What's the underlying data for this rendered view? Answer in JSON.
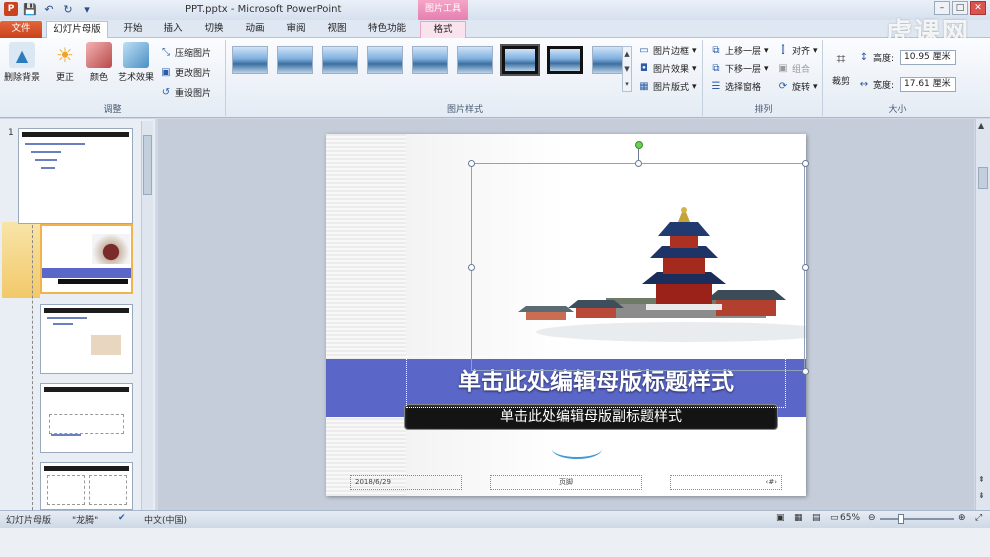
{
  "app": {
    "window_title": "PPT.pptx - Microsoft PowerPoint",
    "context_tool_header": "图片工具",
    "watermark": "虎课网"
  },
  "tabs": [
    {
      "label": "文件"
    },
    {
      "label": "幻灯片母版"
    },
    {
      "label": "开始"
    },
    {
      "label": "插入"
    },
    {
      "label": "切换"
    },
    {
      "label": "动画"
    },
    {
      "label": "审阅"
    },
    {
      "label": "视图"
    },
    {
      "label": "特色功能"
    },
    {
      "label": "格式"
    }
  ],
  "ribbon": {
    "adjust": {
      "remove_bg": "删除背景",
      "correct": "更正",
      "color": "颜色",
      "art_effects": "艺术效果",
      "compress": "压缩图片",
      "change": "更改图片",
      "reset": "重设图片",
      "group_label": "调整"
    },
    "styles": {
      "group_label": "图片样式",
      "border": "图片边框",
      "effects": "图片效果",
      "layout": "图片版式"
    },
    "arrange": {
      "group_label": "排列",
      "bring_forward": "上移一层",
      "send_backward": "下移一层",
      "selection_pane": "选择窗格",
      "align": "对齐",
      "group": "组合",
      "rotate": "旋转"
    },
    "size": {
      "group_label": "大小",
      "crop": "裁剪",
      "height_label": "高度:",
      "height_value": "10.95 厘米",
      "width_label": "宽度:",
      "width_value": "17.61 厘米"
    }
  },
  "slides_panel": {
    "first_slide_number": "1"
  },
  "slide": {
    "title_placeholder": "单击此处编辑母版标题样式",
    "subtitle_placeholder": "单击此处编辑母版副标题样式",
    "date": "2018/6/29",
    "footer": "页脚",
    "page_number": "‹#›"
  },
  "statusbar": {
    "view_name": "幻灯片母版",
    "theme": "\"龙腾\"",
    "language": "中文(中国)",
    "zoom": "65%"
  },
  "colors": {
    "accent_file_tab": "#d0491f",
    "title_band": "#5a66c8",
    "context_header": "#e67fb0"
  }
}
